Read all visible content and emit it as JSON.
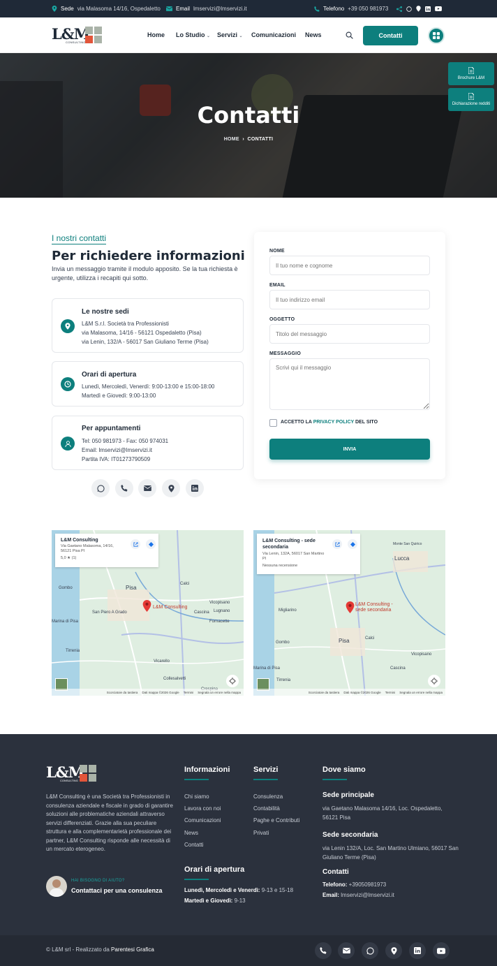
{
  "topbar": {
    "sede_label": "Sede",
    "sede_value": "via Malasoma 14/16, Ospedaletto",
    "email_label": "Email",
    "email_value": "lmservizi@lmservizi.it",
    "telefono_label": "Telefono",
    "telefono_value": "+39 050 981973"
  },
  "header": {
    "logo_text": "L&M",
    "logo_sub": "CONSULTING",
    "nav": [
      "Home",
      "Lo Studio",
      "Servizi",
      "Comunicazioni",
      "News"
    ],
    "cta": "Contatti"
  },
  "hero": {
    "title": "Contatti",
    "breadcrumb_home": "HOME",
    "breadcrumb_current": "CONTATTI",
    "side_buttons": [
      "Brochure L&M",
      "Dichiarazione redditi"
    ]
  },
  "contacts": {
    "kicker": "I nostri contatti",
    "title": "Per richiedere informazioni",
    "intro": "Invia un messaggio tramite il modulo apposito. Se la tua richiesta è urgente, utilizza i recapiti qui sotto.",
    "cards": [
      {
        "title": "Le nostre sedi",
        "lines": [
          "L&M S.r.l. Società tra Professionisti",
          "via Malasoma, 14/16 - 56121 Ospedaletto (Pisa)",
          "via Lenin, 132/A - 56017 San Giuliano Terme (Pisa)"
        ]
      },
      {
        "title": "Orari di apertura",
        "lines": [
          "Lunedì, Mercoledì, Venerdì: 9:00-13:00 e 15:00-18:00",
          "Martedì e Giovedì: 9:00-13:00"
        ]
      },
      {
        "title": "Per appuntamenti",
        "lines": [
          "Tel: 050 981973 - Fax: 050 974031",
          "Email: lmservizi@lmservizi.it",
          "Partita IVA: IT01273790509"
        ]
      }
    ]
  },
  "form": {
    "name_label": "NOME",
    "name_placeholder": "Il tuo nome e cognome",
    "email_label": "EMAIL",
    "email_placeholder": "Il tuo indirizzo email",
    "subject_label": "OGGETTO",
    "subject_placeholder": "Titolo del messaggio",
    "message_label": "MESSAGGIO",
    "message_placeholder": "Scrivi qui il messaggio",
    "accept_prefix": "ACCETTO LA",
    "privacy_link": "PRIVACY POLICY",
    "accept_suffix": "DEL SITO",
    "submit": "INVIA"
  },
  "maps": [
    {
      "title": "L&M Consulting",
      "address": "Via Gaetano Malasoma, 14/16, 56121 Pisa PI",
      "rating": "5,0 ★ (1)",
      "pin_label": "L&M Consulting",
      "towns": [
        "Pisa",
        "Gombo",
        "Marina di Pisa",
        "Tirrenia",
        "Calci",
        "Vicopisano",
        "Cascina",
        "Lugnano",
        "Fornacette",
        "Vicarello",
        "Collesalvetti",
        "San Piero A Grado",
        "Crespina"
      ],
      "footer": [
        "Scorciatoie da tastiera",
        "Dati mappa ©2026 Google",
        "Termini",
        "Segnala un errore nella mappa"
      ]
    },
    {
      "title": "L&M Consulting - sede secondaria",
      "address": "Via Lenin, 132A, 56017 San Martino PI",
      "rating": "Nessuna recensione",
      "pin_label": "L&M Consulting - sede secondaria",
      "towns": [
        "Lucca",
        "Migliarino",
        "Pisa",
        "Gombo",
        "Calci",
        "Vicopisano",
        "Marina di Pisa",
        "Cascina",
        "Tirrenia",
        "Monte San Quirico"
      ],
      "footer": [
        "Scorciatoie da tastiera",
        "Dati mappa ©2026 Google",
        "Termini",
        "Segnala un errore nella mappa"
      ]
    }
  ],
  "footer": {
    "about": "L&M Consulting è una Società tra Professionisti in consulenza aziendale e fiscale in grado di garantire soluzioni alle problematiche aziendali attraverso servizi differenziati. Grazie alla sua peculiare struttura e alla complementarietà professionale dei partner, L&M Consulting risponde alle necessità di un mercato eterogeneo.",
    "help_kicker": "HAI BISOGNO DI AIUTO?",
    "help_link": "Contattaci per una consulenza",
    "info_title": "Informazioni",
    "info_links": [
      "Chi siamo",
      "Lavora con noi",
      "Comunicazioni",
      "News",
      "Contatti"
    ],
    "services_title": "Servizi",
    "services_links": [
      "Consulenza",
      "Contabilità",
      "Paghe e Contributi",
      "Privati"
    ],
    "hours_title": "Orari di apertura",
    "hours": [
      {
        "days": "Lunedì, Mercoledì e Venerdì:",
        "time": "9-13 e 15-18"
      },
      {
        "days": "Martedì e Giovedì:",
        "time": "9-13"
      }
    ],
    "where_title": "Dove siamo",
    "main_title": "Sede principale",
    "main_address": "via Gaetano Malasoma 14/16, Loc. Ospedaletto, 56121 Pisa",
    "second_title": "Sede secondaria",
    "second_address": "via Lenin 132/A, Loc. San Martino Ulmiano, 56017 San Giuliano Terme (Pisa)",
    "contacts_title": "Contatti",
    "phone_label": "Telefono:",
    "phone_value": "+39050981973",
    "email_label": "Email:",
    "email_value": "lmservizi@lmservizi.it",
    "copyright_prefix": "© L&M srl - Realizzato da",
    "copyright_author": "Parentesi Grafica"
  }
}
